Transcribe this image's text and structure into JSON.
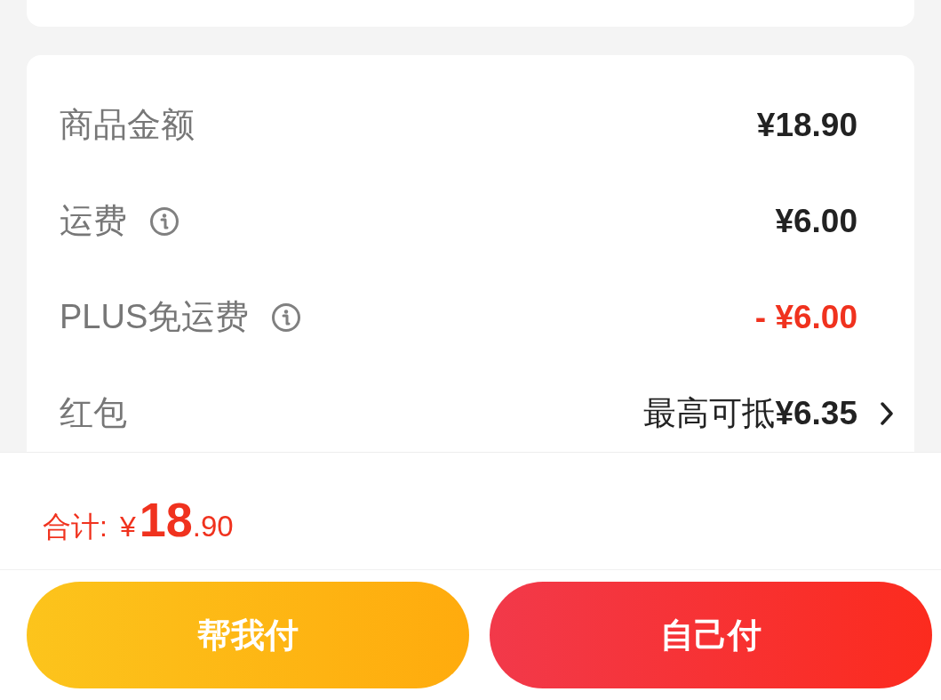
{
  "fees": [
    {
      "label": "商品金额",
      "info": false,
      "value": "¥18.90",
      "kind": "amount"
    },
    {
      "label": "运费",
      "info": true,
      "value": "¥6.00",
      "kind": "amount"
    },
    {
      "label": "PLUS免运费",
      "info": true,
      "value": "- ¥6.00",
      "kind": "discount"
    },
    {
      "label": "红包",
      "info": false,
      "value": "最高可抵**¥6.35**",
      "kind": "option"
    }
  ],
  "total": {
    "label": "合计:",
    "currency": "¥",
    "whole": "18",
    "fraction": ".90"
  },
  "buttons": [
    {
      "label": "帮我付",
      "kind": "secondary"
    },
    {
      "label": "自己付",
      "kind": "primary"
    }
  ]
}
